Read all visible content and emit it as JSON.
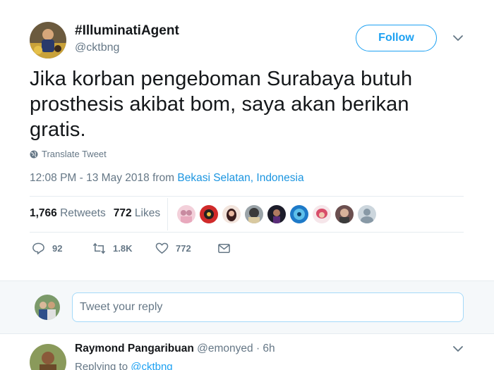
{
  "tweet": {
    "display_name": "#IlluminatiAgent",
    "handle": "@cktbng",
    "follow_label": "Follow",
    "text": "Jika korban pengeboman Surabaya butuh prosthesis akibat bom, saya akan berikan gratis.",
    "translate_label": "Translate Tweet",
    "timestamp": "12:08 PM - 13 May 2018",
    "from_label": "from",
    "location": "Bekasi Selatan, Indonesia",
    "retweets_count": "1,766",
    "retweets_label": "Retweets",
    "likes_count": "772",
    "likes_label": "Likes",
    "likers": [
      "liker-1",
      "liker-2",
      "liker-3",
      "liker-4",
      "liker-5",
      "liker-6",
      "liker-7",
      "liker-8",
      "liker-9"
    ],
    "actions": {
      "reply_count": "92",
      "retweet_count": "1.8K",
      "like_count": "772"
    }
  },
  "reply_composer": {
    "placeholder": "Tweet your reply"
  },
  "replies": [
    {
      "name": "Raymond Pangaribuan",
      "handle": "@emonyed",
      "time": "6h",
      "separator": "·",
      "replying_label": "Replying to",
      "replying_to": "@cktbng"
    }
  ],
  "colors": {
    "accent": "#1da1f2",
    "link": "#1b95e0",
    "muted": "#657786",
    "text": "#14171a"
  },
  "icons": {
    "caret": "chevron-down-icon",
    "translate": "globe-icon",
    "reply": "reply-icon",
    "retweet": "retweet-icon",
    "like": "heart-icon",
    "dm": "envelope-icon"
  }
}
